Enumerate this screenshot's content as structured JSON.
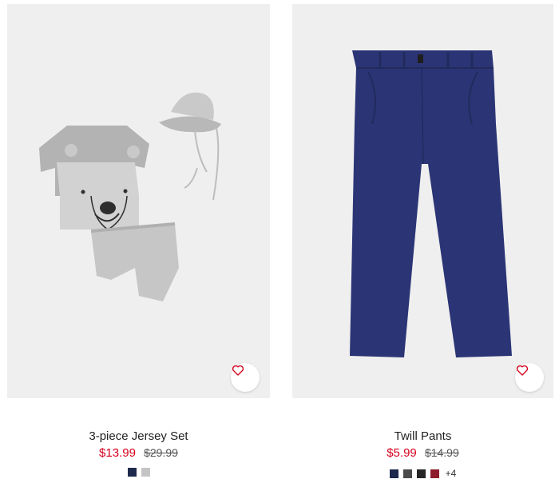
{
  "products": [
    {
      "title": "3-piece Jersey Set",
      "price": "$13.99",
      "old_price": "$29.99",
      "swatches": [
        "#1d2a4d",
        "#c4c4c4"
      ],
      "more": ""
    },
    {
      "title": "Twill Pants",
      "price": "$5.99",
      "old_price": "$14.99",
      "swatches": [
        "#1d2a4d",
        "#4a4a4a",
        "#262626",
        "#8e1b2c"
      ],
      "more": "+4"
    }
  ],
  "colors": {
    "sale": "#d6001c",
    "favorite": "#d6001c",
    "image_bg": "#efefef"
  },
  "icons": {
    "favorite": "heart-icon"
  }
}
